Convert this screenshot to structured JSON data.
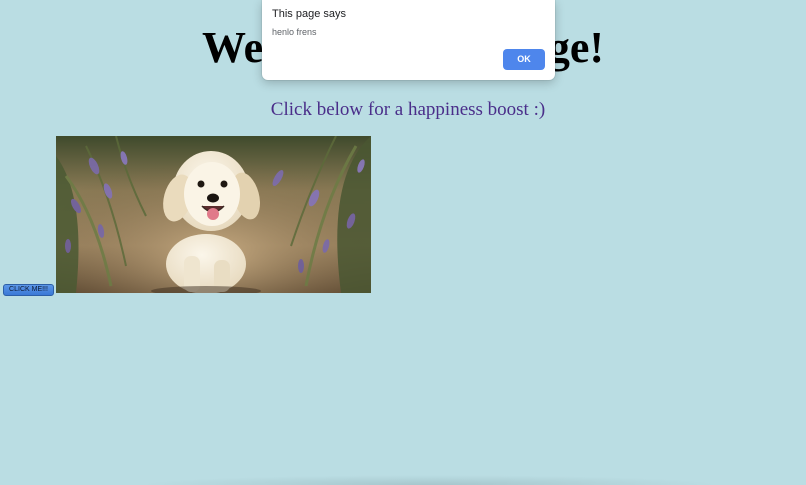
{
  "page": {
    "heading": "Welcome to my page!",
    "subheading": "Click below for a happiness boost :)",
    "background_color": "#badde3"
  },
  "image": {
    "description_icon": "puppy-photo"
  },
  "button": {
    "label": "CLICK ME!!!"
  },
  "dialog": {
    "title": "This page says",
    "message": "henlo frens",
    "ok_label": "OK",
    "ok_color": "#4e86ec"
  }
}
